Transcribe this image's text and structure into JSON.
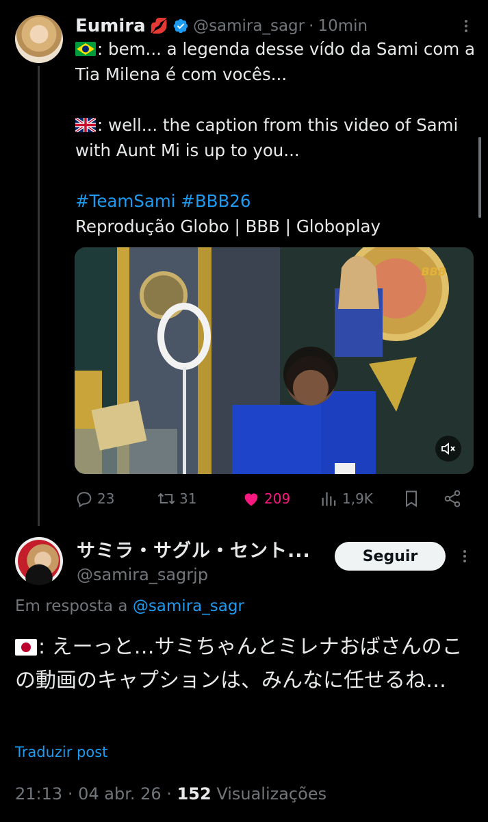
{
  "tweet1": {
    "display_name": "Eumira",
    "name_emoji": "lips",
    "verified": true,
    "handle": "@samira_sagr",
    "time": "10min",
    "text_pt": ": bem... a legenda desse vído da Sami com a Tia Milena é com vocês...",
    "text_en": ": well... the caption from this video of Sami with Aunt Mi is up to you...",
    "hashtags": "#TeamSami #BBB26",
    "credit": "Reprodução Globo | BBB | Globoplay",
    "media_badge": "BBB",
    "stats": {
      "replies": "23",
      "retweets": "31",
      "likes": "209",
      "views": "1,9K"
    },
    "icons": [
      "reply-icon",
      "retweet-icon",
      "heart-icon",
      "views-icon",
      "bookmark-icon",
      "share-icon",
      "mute-icon",
      "more-icon"
    ]
  },
  "tweet2": {
    "display_name": "サミラ・サグル・セント...",
    "handle": "@samira_sagrjp",
    "follow_label": "Seguir",
    "reply_prefix": "Em resposta a",
    "reply_mention": "@samira_sagr",
    "text": ": えーっと…サミちゃんとミレナおばさんのこの動画のキャプションは、みんなに任せるね…",
    "translate_label": "Traduzir post",
    "time": "21:13",
    "date": "04 abr. 26",
    "views": "152",
    "views_label": "Visualizações"
  },
  "colors": {
    "background": "#000000",
    "text": "#e7e9ea",
    "muted": "#71767b",
    "link": "#1d9bf0",
    "like": "#f91880"
  }
}
